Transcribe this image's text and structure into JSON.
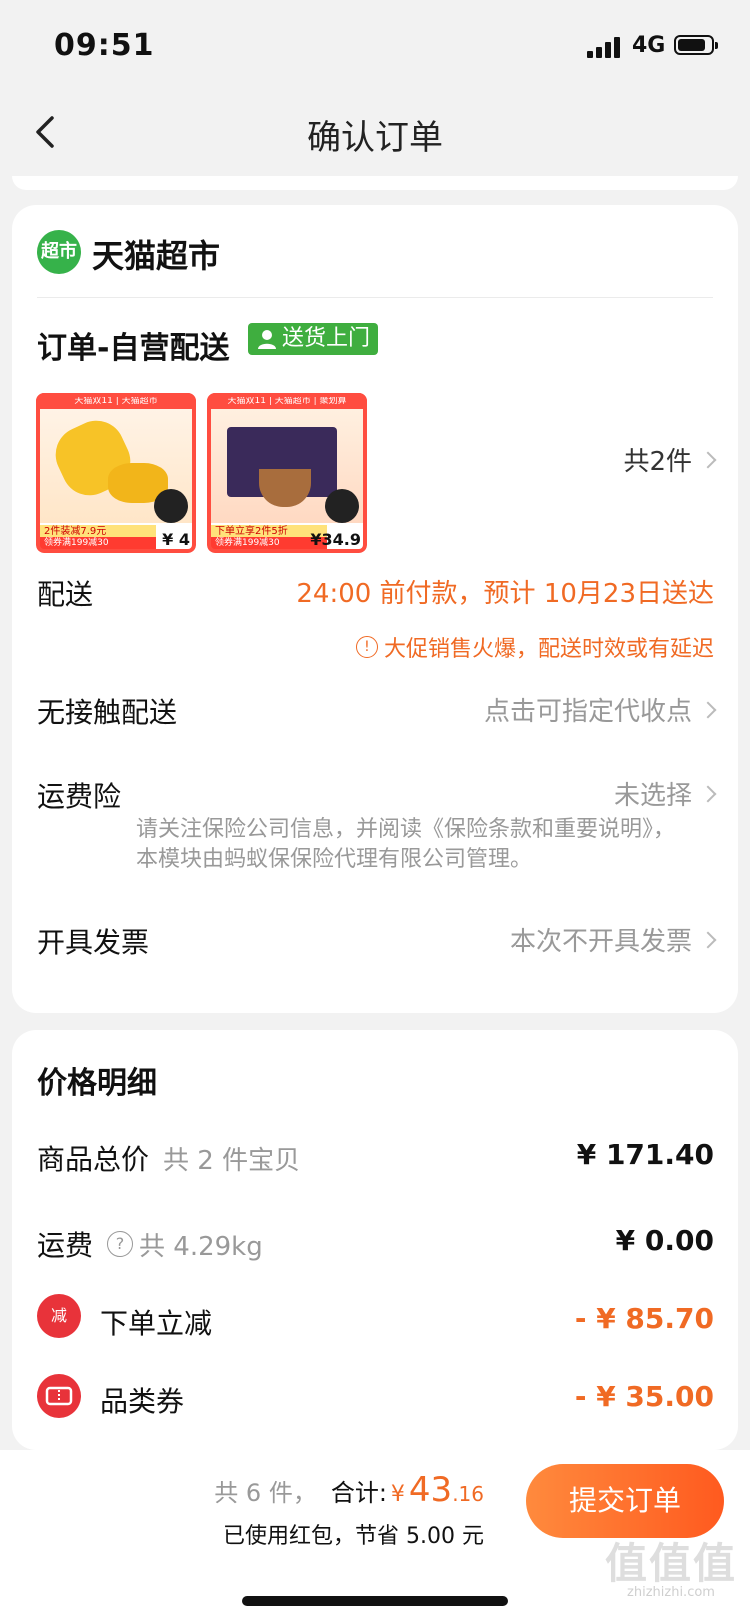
{
  "status_bar": {
    "time": "09:51",
    "network": "4G"
  },
  "nav": {
    "title": "确认订单"
  },
  "store": {
    "logo_text": "超市",
    "name": "天猫超市",
    "order_type": "订单-自营配送",
    "delivery_badge": "送货上门",
    "products": [
      {
        "top_banner": "天猫双11 | 天猫超市",
        "promo": "2件装减7.9元",
        "coupon": "领券满199减30",
        "price": "¥ 4"
      },
      {
        "top_banner": "天猫双11 | 天猫超市 | 聚划算",
        "promo": "下单立享2件5折",
        "coupon": "领券满199减30",
        "price": "¥34.9"
      }
    ],
    "quantity_text": "共2件"
  },
  "delivery": {
    "label": "配送",
    "value": "24:00 前付款，预计 10月23日送达",
    "warning": "大促销售火爆，配送时效或有延迟"
  },
  "contactless": {
    "label": "无接触配送",
    "value": "点击可指定代收点"
  },
  "insurance": {
    "label": "运费险",
    "value": "未选择",
    "note": "请关注保险公司信息，并阅读《保险条款和重要说明》，本模块由蚂蚁保保险代理有限公司管理。"
  },
  "invoice": {
    "label": "开具发票",
    "value": "本次不开具发票"
  },
  "price_detail": {
    "title": "价格明细",
    "items_total_label": "商品总价",
    "items_total_sub": "共 2 件宝贝",
    "items_total_value": "¥ 171.40",
    "shipping_label": "运费",
    "shipping_sub": "共 4.29kg",
    "shipping_value": "¥ 0.00",
    "discount_icon_text": "减",
    "discount_label": "下单立减",
    "discount_value": "- ¥ 85.70",
    "coupon_label": "品类券",
    "coupon_value": "- ¥ 35.00"
  },
  "bottom": {
    "count_text": "共 6 件，",
    "total_label": "合计:",
    "currency": "¥",
    "amount_int": "43",
    "amount_dec": ".16",
    "savings_text": "已使用红包，节省 5.00 元",
    "submit_label": "提交订单"
  },
  "watermark": {
    "glyphs": "值值值",
    "site": "zhizhizhi.com"
  },
  "colors": {
    "accent": "#f06a24",
    "green": "#3fae3f",
    "red": "#e8333a"
  }
}
